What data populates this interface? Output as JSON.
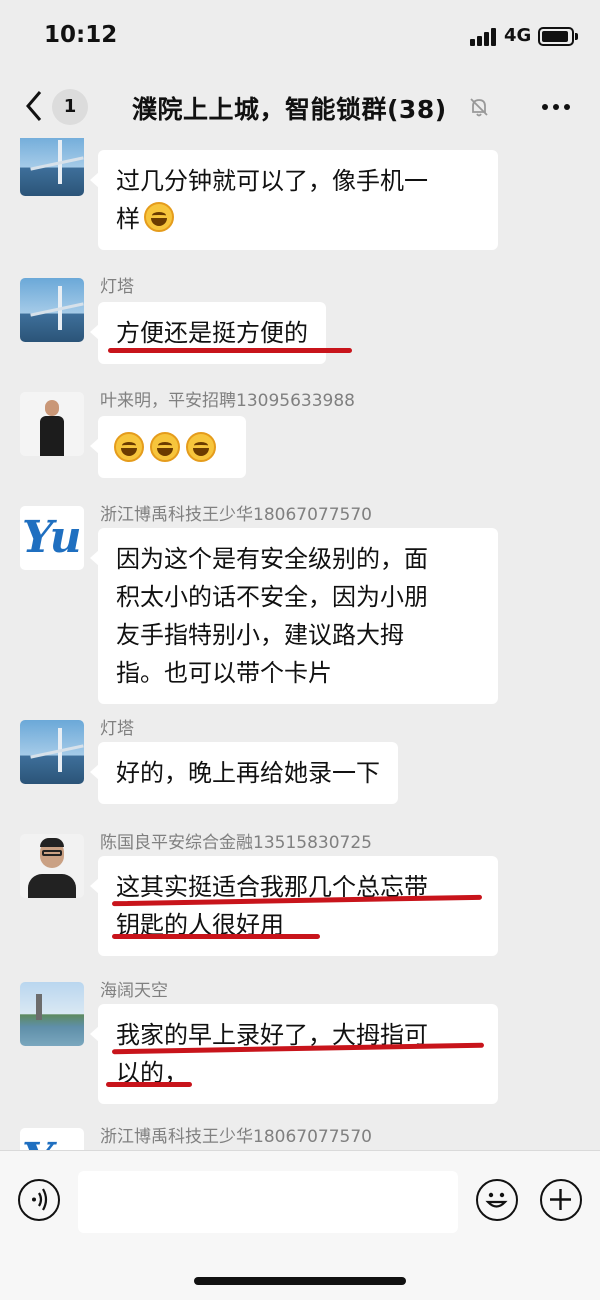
{
  "status_bar": {
    "time": "10:12",
    "network": "4G"
  },
  "header": {
    "unread_count": "1",
    "title": "濮院上上城，智能锁群(38)"
  },
  "icons": {
    "back": "chevron-left-icon",
    "mute": "bell-slash-icon",
    "more": "more-dots-icon",
    "voice": "voice-icon",
    "emoji": "smiley-icon",
    "plus": "plus-icon"
  },
  "colors": {
    "background": "#ededed",
    "bubble": "#ffffff",
    "annotation": "#c8141b"
  },
  "messages": [
    {
      "sender": "",
      "lines": [
        "过几分钟就可以了，像手机一",
        "样"
      ],
      "emoji": "grinning-squint-emoji"
    },
    {
      "sender": "灯塔",
      "lines": [
        "方便还是挺方便的"
      ]
    },
    {
      "sender": "叶来明，平安招聘13095633988",
      "lines": [
        ""
      ],
      "emoji": "grinning-emoji x3"
    },
    {
      "sender": "浙江博禹科技王少华18067077570",
      "lines": [
        "因为这个是有安全级别的，面",
        "积太小的话不安全，因为小朋",
        "友手指特别小，建议路大拇",
        "指。也可以带个卡片"
      ]
    },
    {
      "sender": "灯塔",
      "lines": [
        "好的，晚上再给她录一下"
      ]
    },
    {
      "sender": "陈国良平安综合金融13515830725",
      "lines": [
        "这其实挺适合我那几个总忘带",
        "钥匙的人很好用"
      ]
    },
    {
      "sender": "海阔天空",
      "lines": [
        "我家的早上录好了，大拇指可",
        "以的，"
      ]
    },
    {
      "sender": "浙江博禹科技王少华18067077570",
      "lines": [
        ""
      ]
    }
  ],
  "input": {
    "placeholder": ""
  }
}
